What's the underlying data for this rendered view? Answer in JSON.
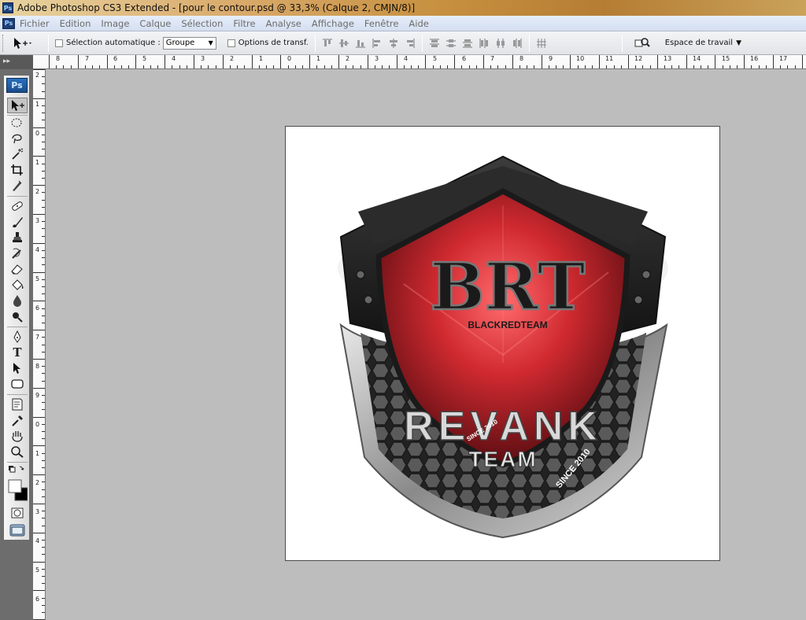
{
  "window": {
    "title": "Adobe Photoshop CS3 Extended - [pour le contour.psd @ 33,3% (Calque 2, CMJN/8)]",
    "app_icon": "Ps"
  },
  "menu": [
    "Fichier",
    "Edition",
    "Image",
    "Calque",
    "Sélection",
    "Filtre",
    "Analyse",
    "Affichage",
    "Fenêtre",
    "Aide"
  ],
  "options": {
    "auto_select_label": "Sélection automatique :",
    "auto_select_value": "Groupe",
    "transform_label": "Options de transf.",
    "workspace_label": "Espace de travail"
  },
  "toolbox": {
    "logo": "Ps",
    "tools": [
      "move",
      "marquee",
      "lasso",
      "magic-wand",
      "crop",
      "slice",
      "healing",
      "brush",
      "stamp",
      "history-brush",
      "eraser",
      "paint-bucket",
      "blur",
      "dodge",
      "pen",
      "type",
      "path-selection",
      "shape",
      "notes",
      "eyedropper",
      "hand",
      "zoom"
    ],
    "type_glyph": "T"
  },
  "rulers": {
    "horizontal": [
      "8",
      "7",
      "6",
      "5",
      "4",
      "3",
      "2",
      "1",
      "0",
      "1",
      "2",
      "3",
      "4",
      "5",
      "6",
      "7",
      "8",
      "9",
      "10",
      "11",
      "12",
      "13",
      "14",
      "15",
      "16",
      "17"
    ],
    "vertical": [
      "2",
      "1",
      "0",
      "1",
      "2",
      "3",
      "4",
      "5",
      "6",
      "7",
      "8",
      "9",
      "0",
      "1",
      "2",
      "3",
      "4",
      "5",
      "6"
    ]
  },
  "artwork": {
    "main_text": "BRT",
    "subtitle": "BLACKREDTEAM",
    "banner_text": "REVANK",
    "team_text": "TEAM",
    "since_left": "SINCE 2010",
    "since_right": "SINCE 2010"
  },
  "colors": {
    "shield_red": "#c6242a",
    "shield_dark": "#1c1c1c",
    "metal": "#9a9a9a",
    "canvas_bg": "#bdbdbd"
  }
}
